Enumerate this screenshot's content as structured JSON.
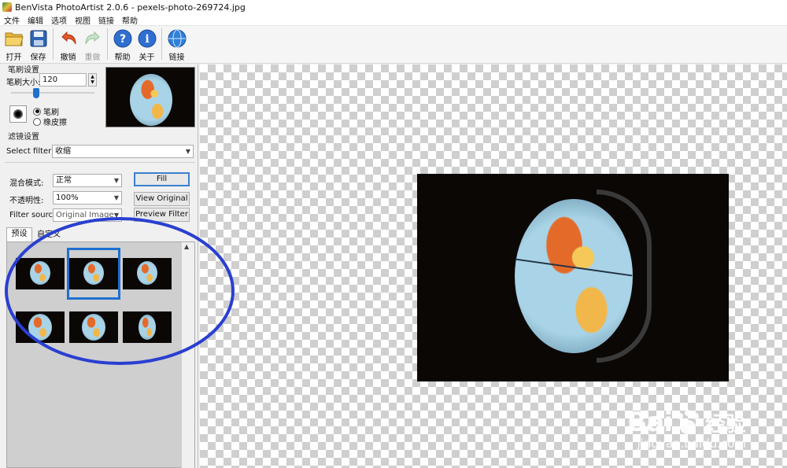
{
  "window": {
    "title": "BenVista PhotoArtist 2.0.6 - pexels-photo-269724.jpg"
  },
  "menu": [
    "文件",
    "编辑",
    "选项",
    "视图",
    "链接",
    "帮助"
  ],
  "toolbar": {
    "open": "打开",
    "save": "保存",
    "undo": "撤销",
    "redo": "重做",
    "help": "帮助",
    "about": "关于",
    "link": "链接"
  },
  "brush": {
    "group_title": "笔刷设置",
    "size_label": "笔刷大小:",
    "size_value": "120",
    "mode_brush": "笔刷",
    "mode_eraser": "橡皮擦",
    "slider_level": 0.3
  },
  "filter": {
    "group_title": "滤镜设置",
    "select_label": "Select filter:",
    "select_value": "收缩",
    "blend_label": "混合模式:",
    "blend_value": "正常",
    "opacity_label": "不透明性:",
    "opacity_value": "100%",
    "source_label": "Filter source:",
    "source_value": "Original Image",
    "fill_button": "Fill",
    "view_original_button": "View Original",
    "preview_filter_button": "Preview Filter"
  },
  "tabs": {
    "presets": "预设",
    "custom": "自定义"
  },
  "watermark": {
    "brand": "Bai",
    "brand2": "经验",
    "url": "jingyan.baidu.com"
  },
  "colors": {
    "selection": "#1f6fd0",
    "annotation": "#2a3fd0"
  }
}
